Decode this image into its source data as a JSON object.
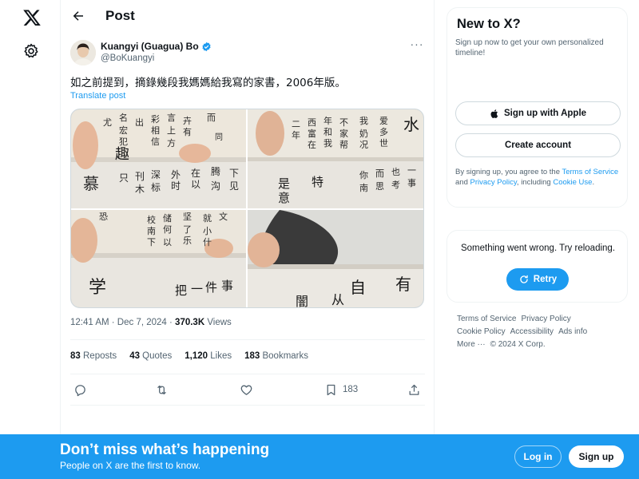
{
  "nav": {
    "logo_icon": "x-logo-icon",
    "settings_icon": "gear-icon"
  },
  "header": {
    "title": "Post",
    "back_icon": "arrow-left-icon"
  },
  "post": {
    "author_name": "Kuangyi (Guagua) Bo",
    "author_handle": "@BoKuangyi",
    "text": "如之前提到，摘錄幾段我媽媽給我寫的家書，2006年版。",
    "translate_label": "Translate post",
    "timestamp": "12:41 AM · Dec 7, 2024 · ",
    "views_count": "370.3K",
    "views_label": " Views",
    "stats": {
      "reposts_count": "83",
      "reposts_label": " Reposts",
      "quotes_count": "43",
      "quotes_label": " Quotes",
      "likes_count": "1,120",
      "likes_label": " Likes",
      "bookmarks_count": "183",
      "bookmarks_label": " Bookmarks"
    },
    "actions": {
      "bookmark_count": "183"
    }
  },
  "signup_card": {
    "title": "New to X?",
    "subtitle": "Sign up now to get your own personalized timeline!",
    "apple_button": "Sign up with Apple",
    "create_button": "Create account",
    "legal_prefix": "By signing up, you agree to the ",
    "terms_link": "Terms of Service",
    "legal_and": " and ",
    "privacy_link": "Privacy Policy",
    "legal_including": ", including ",
    "cookie_link": "Cookie Use",
    "legal_end": "."
  },
  "error_card": {
    "message": "Something went wrong. Try reloading.",
    "retry_label": "Retry"
  },
  "footer": {
    "terms": "Terms of Service",
    "privacy": "Privacy Policy",
    "cookie": "Cookie Policy",
    "accessibility": "Accessibility",
    "ads": "Ads info",
    "more": "More ···",
    "copyright": "© 2024 X Corp."
  },
  "banner": {
    "title": "Don’t miss what’s happening",
    "subtitle": "People on X are the first to know.",
    "login_label": "Log in",
    "signup_label": "Sign up"
  },
  "colors": {
    "accent": "#1d9bf0",
    "text": "#0f1419",
    "muted": "#536471",
    "border": "#eff3f4"
  }
}
